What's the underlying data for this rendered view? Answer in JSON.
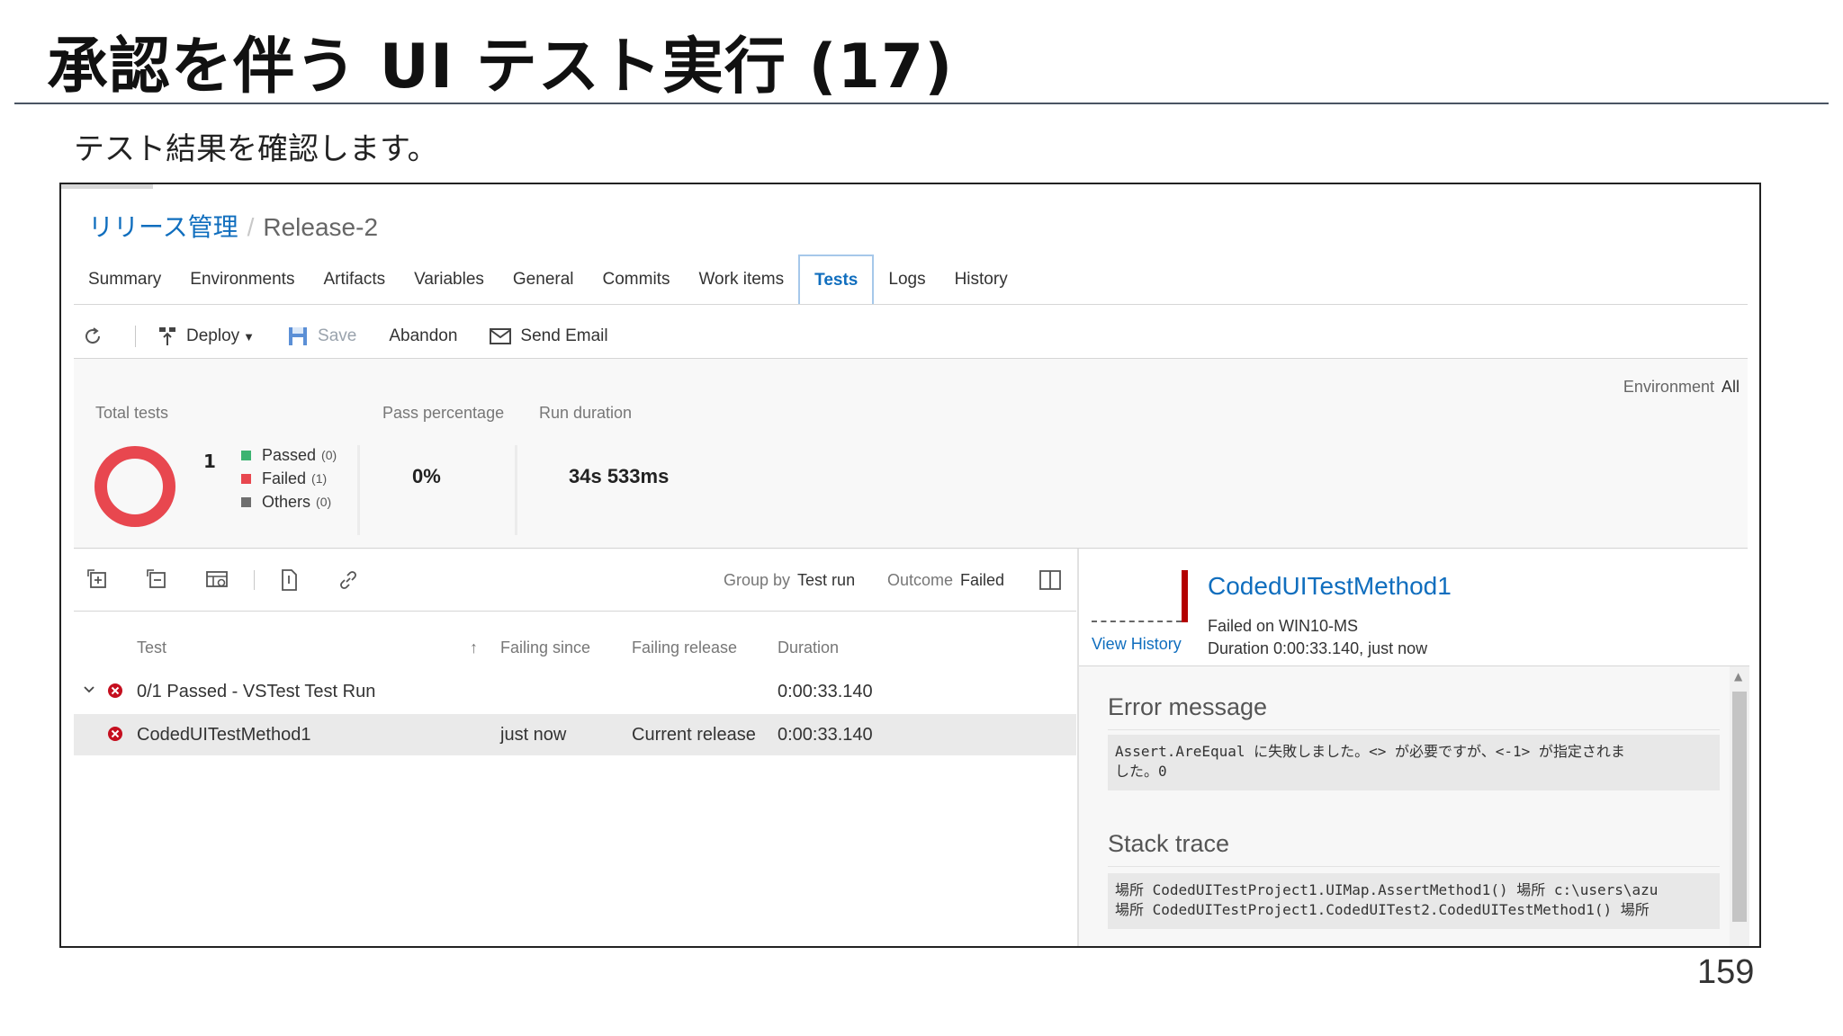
{
  "slide": {
    "title": "承認を伴う UI テスト実行 (17)",
    "subtitle": "テスト結果を確認します。",
    "page_number": "159"
  },
  "breadcrumb": {
    "root": "リリース管理",
    "separator": "/",
    "current": "Release-2"
  },
  "tabs": [
    {
      "label": "Summary",
      "active": false
    },
    {
      "label": "Environments",
      "active": false
    },
    {
      "label": "Artifacts",
      "active": false
    },
    {
      "label": "Variables",
      "active": false
    },
    {
      "label": "General",
      "active": false
    },
    {
      "label": "Commits",
      "active": false
    },
    {
      "label": "Work items",
      "active": false
    },
    {
      "label": "Tests",
      "active": true
    },
    {
      "label": "Logs",
      "active": false
    },
    {
      "label": "History",
      "active": false
    }
  ],
  "toolbar": {
    "refresh_icon": "refresh-icon",
    "deploy_label": "Deploy",
    "save_label": "Save",
    "abandon_label": "Abandon",
    "send_email_label": "Send Email"
  },
  "summary": {
    "environment_label": "Environment",
    "environment_value": "All",
    "total_tests_label": "Total tests",
    "total_tests_value": "1",
    "legend": [
      {
        "label": "Passed",
        "count": "(0)",
        "color": "#3cb371"
      },
      {
        "label": "Failed",
        "count": "(1)",
        "color": "#e8474f"
      },
      {
        "label": "Others",
        "count": "(0)",
        "color": "#6f6f6f"
      }
    ],
    "pass_percentage_label": "Pass percentage",
    "pass_percentage_value": "0%",
    "run_duration_label": "Run duration",
    "run_duration_value": "34s 533ms",
    "donut_failed_fraction": 1.0
  },
  "grid": {
    "group_by_label": "Group by",
    "group_by_value": "Test run",
    "outcome_label": "Outcome",
    "outcome_value": "Failed",
    "columns": {
      "test": "Test",
      "failing_since": "Failing since",
      "failing_release": "Failing release",
      "duration": "Duration"
    },
    "rows": [
      {
        "test": "0/1 Passed - VSTest Test Run",
        "failing_since": "",
        "failing_release": "",
        "duration": "0:00:33.140"
      },
      {
        "test": "CodedUITestMethod1",
        "failing_since": "just now",
        "failing_release": "Current release",
        "duration": "0:00:33.140"
      }
    ]
  },
  "detail": {
    "title": "CodedUITestMethod1",
    "failed_on": "Failed on WIN10-MS",
    "duration_line": "Duration 0:00:33.140, just now",
    "view_history": "View History",
    "error_message_title": "Error message",
    "error_message_lines": [
      "Assert.AreEqual に失敗しました。<> が必要ですが、<-1> が指定されま",
      "した。0"
    ],
    "stack_trace_title": "Stack trace",
    "stack_trace_lines": [
      "場所 CodedUITestProject1.UIMap.AssertMethod1() 場所 c:\\users\\azu",
      "場所 CodedUITestProject1.CodedUITest2.CodedUITestMethod1() 場所"
    ]
  },
  "colors": {
    "accent": "#106ebe",
    "failed": "#e8474f",
    "fail_icon": "#c50f1f",
    "history_bar": "#b30000"
  }
}
